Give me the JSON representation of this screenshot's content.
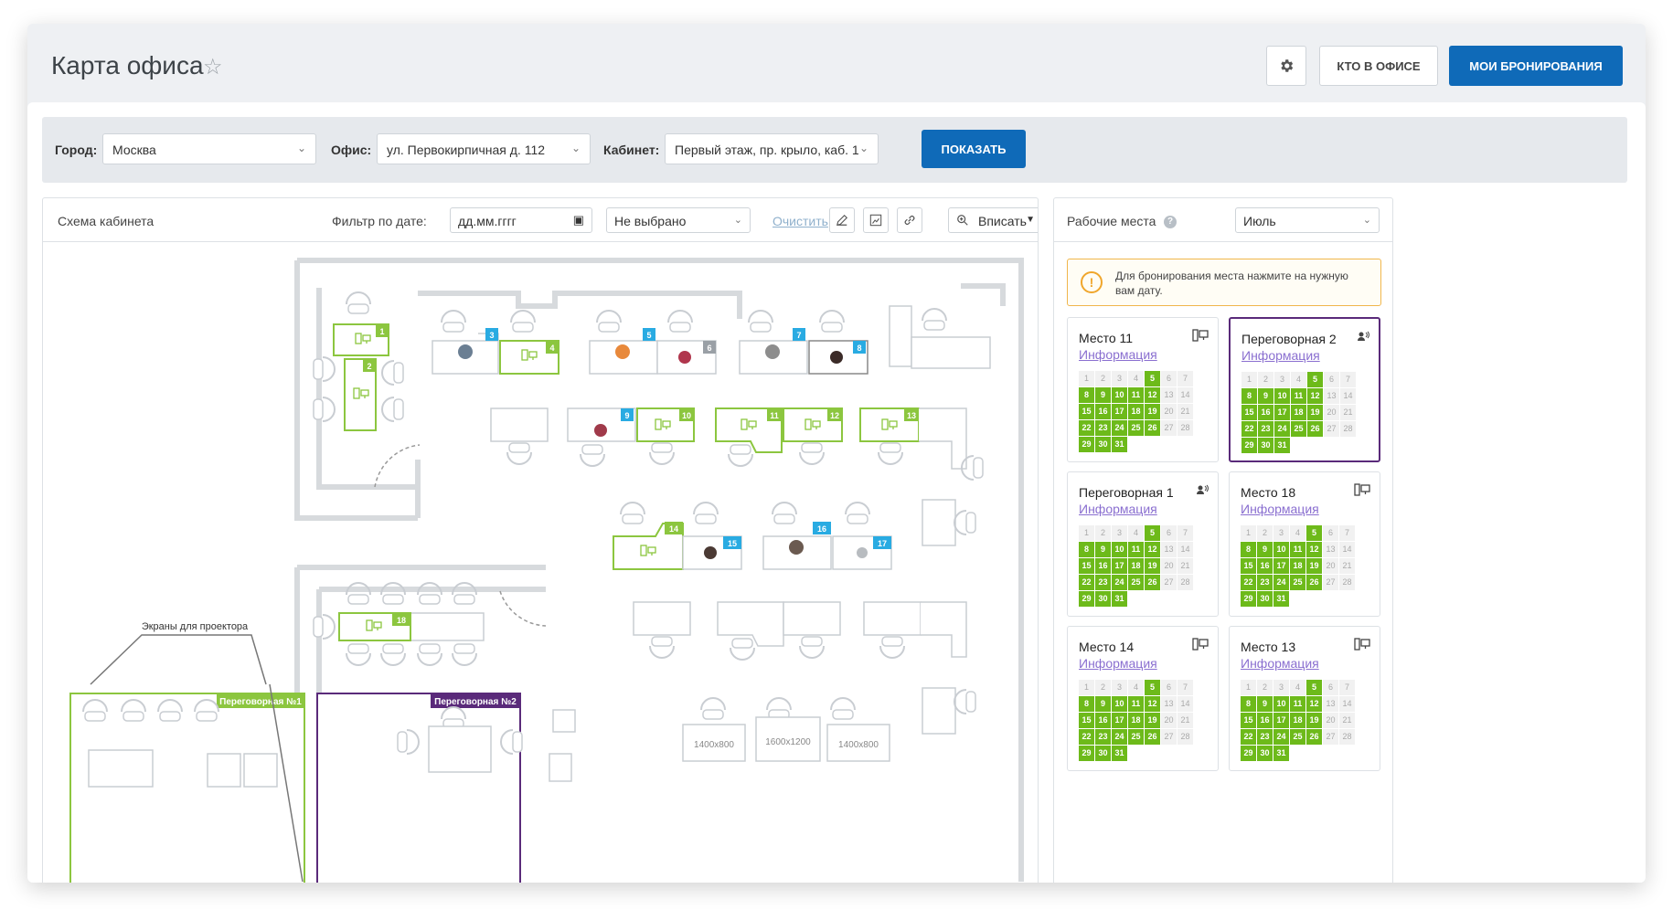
{
  "header": {
    "title": "Карта офиса",
    "who_button": "КТО В ОФИСЕ",
    "my_bookings_button": "МОИ БРОНИРОВАНИЯ"
  },
  "filters": {
    "city_label": "Город:",
    "city_value": "Москва",
    "office_label": "Офис:",
    "office_value": "ул. Первокирпичная д. 112",
    "cabinet_label": "Кабинет:",
    "cabinet_value": "Первый этаж, пр. крыло, каб. 1",
    "show_button": "ПОКАЗАТЬ"
  },
  "scheme": {
    "title": "Схема кабинета",
    "date_filter_label": "Фильтр по дате:",
    "date_placeholder": "дд.мм.гггг",
    "select_value": "Не выбрано",
    "clear_link": "Очистить",
    "zoom_label": "Вписать"
  },
  "map_labels": {
    "projector": "Экраны для проектора",
    "meeting1": "Переговорная №1",
    "meeting2": "Переговорная №2",
    "table1": "1400x800",
    "table2": "1600x1200",
    "table3": "1400x800"
  },
  "seats": [
    "1",
    "2",
    "3",
    "4",
    "5",
    "6",
    "7",
    "8",
    "9",
    "10",
    "11",
    "12",
    "13",
    "14",
    "15",
    "16",
    "17",
    "18"
  ],
  "workplaces": {
    "title": "Рабочие места",
    "help": "?",
    "month": "Июль",
    "hint": "Для бронирования места нажмите на нужную вам дату.",
    "info_link": "Информация",
    "cards": [
      {
        "name": "Место 11",
        "icon": "desk-icon"
      },
      {
        "name": "Переговорная 2",
        "icon": "meeting-icon"
      },
      {
        "name": "Переговорная 1",
        "icon": "meeting-icon"
      },
      {
        "name": "Место 18",
        "icon": "desk-icon"
      },
      {
        "name": "Место 14",
        "icon": "desk-icon"
      },
      {
        "name": "Место 13",
        "icon": "desk-icon"
      }
    ]
  },
  "calendar": {
    "days": [
      "1",
      "2",
      "3",
      "4",
      "5",
      "6",
      "7",
      "8",
      "9",
      "10",
      "11",
      "12",
      "13",
      "14",
      "15",
      "16",
      "17",
      "18",
      "19",
      "20",
      "21",
      "22",
      "23",
      "24",
      "25",
      "26",
      "27",
      "28",
      "29",
      "30",
      "31"
    ],
    "available": [
      "5",
      "8",
      "9",
      "10",
      "11",
      "12",
      "15",
      "16",
      "17",
      "18",
      "19",
      "22",
      "23",
      "24",
      "25",
      "26",
      "29",
      "30",
      "31"
    ]
  },
  "colors": {
    "primary": "#0f6ab8",
    "available": "#6dba1a",
    "seat_free": "#8cc63f",
    "seat_busy": "#29abe2",
    "meeting_selected": "#5a2a7a"
  }
}
